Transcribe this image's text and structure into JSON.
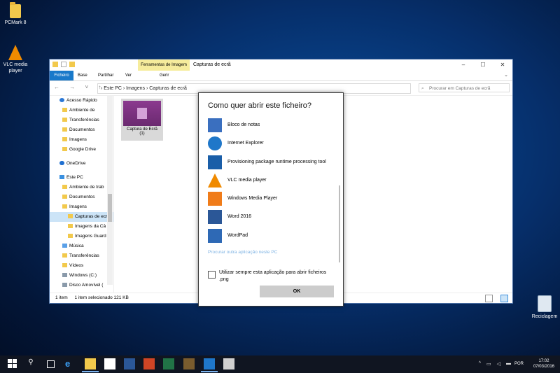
{
  "desktop": {
    "icons": [
      {
        "label": "PCMark 8"
      },
      {
        "label": "VLC media player"
      },
      {
        "label": "Reciclagem"
      }
    ]
  },
  "explorer": {
    "contextual_tab": "Ferramentas de Imagem",
    "title": "Capturas de ecrã",
    "window_buttons": [
      "–",
      "☐",
      "✕"
    ],
    "ribbon_tabs": [
      "Ficheiro",
      "Base",
      "Partilhar",
      "Ver",
      "Gerir"
    ],
    "nav_arrows": "← → ˅ ↑",
    "breadcrumb": "› Este PC › Imagens › Capturas de ecrã",
    "search_placeholder": "Procurar em Capturas de ecrã",
    "nav_pane": [
      {
        "label": "Acesso Rápido",
        "icon": "star",
        "pinned": false
      },
      {
        "label": "Ambiente de",
        "icon": "fold",
        "pinned": true
      },
      {
        "label": "Transferências",
        "icon": "fold",
        "pinned": true
      },
      {
        "label": "Documentos",
        "icon": "fold",
        "pinned": true
      },
      {
        "label": "Imagens",
        "icon": "fold",
        "pinned": true
      },
      {
        "label": "Google Drive",
        "icon": "fold",
        "pinned": true
      },
      {
        "label": "OneDrive",
        "icon": "cloud",
        "pinned": false
      },
      {
        "label": "Este PC",
        "icon": "pc",
        "pinned": false
      },
      {
        "label": "Ambiente de trab",
        "icon": "fold",
        "pinned": false
      },
      {
        "label": "Documentos",
        "icon": "fold",
        "pinned": false
      },
      {
        "label": "Imagens",
        "icon": "fold",
        "pinned": false
      },
      {
        "label": "Capturas de ecr",
        "icon": "fold",
        "pinned": false,
        "selected": true
      },
      {
        "label": "Imagens da Câ",
        "icon": "fold",
        "pinned": false
      },
      {
        "label": "Imagens Guard",
        "icon": "fold",
        "pinned": false
      },
      {
        "label": "Música",
        "icon": "music",
        "pinned": false
      },
      {
        "label": "Transferências",
        "icon": "fold",
        "pinned": false
      },
      {
        "label": "Vídeos",
        "icon": "fold",
        "pinned": false
      },
      {
        "label": "Windows (C:)",
        "icon": "drive",
        "pinned": false
      },
      {
        "label": "Disco Amovível (",
        "icon": "drive",
        "pinned": false
      }
    ],
    "file": {
      "name_line1": "Captura de Ecrã",
      "name_line2": "(1)"
    },
    "status": {
      "count": "1 item",
      "selection": "1 item selecionado 121 KB"
    }
  },
  "dialog": {
    "title": "Como quer abrir este ficheiro?",
    "apps": [
      {
        "label": "Bloco de notas",
        "icon": "notepad-icon"
      },
      {
        "label": "Internet Explorer",
        "icon": "internet-explorer-icon"
      },
      {
        "label": "Provisioning package runtime processing tool",
        "icon": "provisioning-icon"
      },
      {
        "label": "VLC media player",
        "icon": "vlc-icon"
      },
      {
        "label": "Windows Media Player",
        "icon": "windows-media-player-icon"
      },
      {
        "label": "Word 2016",
        "icon": "word-icon"
      },
      {
        "label": "WordPad",
        "icon": "wordpad-icon"
      }
    ],
    "more_link": "Procurar outra aplicação neste PC",
    "always_use_label": "Utilizar sempre esta aplicação para abrir ficheiros .png",
    "always_use_checked": false,
    "ok_label": "OK"
  },
  "taskbar": {
    "language": "POR",
    "time": "17:02",
    "date": "07/03/2016"
  }
}
